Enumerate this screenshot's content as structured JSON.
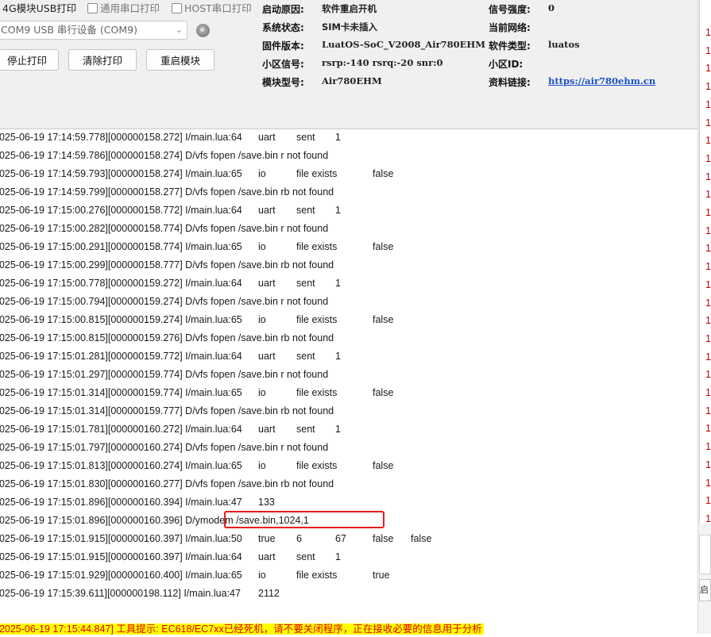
{
  "top": {
    "mode_4g_usb": "4G模块USB打印",
    "mode_uart": "通用串口打印",
    "mode_host": "HOST串口打印",
    "port_value": "COM9 USB 串行设备 (COM9)",
    "stop_label": "停止打印",
    "clear_label": "清除打印",
    "reboot_label": "重启模块"
  },
  "info": {
    "boot_reason_label": "启动原因:",
    "boot_reason": "软件重启开机",
    "sys_state_label": "系统状态:",
    "sys_state": "SIM卡未插入",
    "firmware_label": "固件版本:",
    "firmware": "LuatOS-SoC_V2008_Air780EHM",
    "cell_label": "小区信号:",
    "cell": "rsrp:-140 rsrq:-20 snr:0",
    "model_label": "模块型号:",
    "model": "Air780EHM",
    "signal_label": "信号强度:",
    "signal": "0",
    "network_label": "当前网络:",
    "network": "",
    "soft_type_label": "软件类型:",
    "soft_type": "luatos",
    "cell_id_label": "小区ID:",
    "cell_id": "",
    "link_label": "资料链接:",
    "link": "https://air780ehm.cn"
  },
  "log": [
    {
      "ts": "2025-06-19 17:14:59.778][000000158.272] I/main.lua:64",
      "a": "uart",
      "b": "sent",
      "c": "1"
    },
    {
      "ts": "2025-06-19 17:14:59.786][000000158.274] D/vfs fopen /save.bin r not found"
    },
    {
      "ts": "2025-06-19 17:14:59.793][000000158.274] I/main.lua:65",
      "a": "io",
      "b": "file exists",
      "c": "false"
    },
    {
      "ts": "2025-06-19 17:14:59.799][000000158.277] D/vfs fopen /save.bin rb not found"
    },
    {
      "ts": "2025-06-19 17:15:00.276][000000158.772] I/main.lua:64",
      "a": "uart",
      "b": "sent",
      "c": "1"
    },
    {
      "ts": "2025-06-19 17:15:00.282][000000158.774] D/vfs fopen /save.bin r not found"
    },
    {
      "ts": "2025-06-19 17:15:00.291][000000158.774] I/main.lua:65",
      "a": "io",
      "b": "file exists",
      "c": "false"
    },
    {
      "ts": "2025-06-19 17:15:00.299][000000158.777] D/vfs fopen /save.bin rb not found"
    },
    {
      "ts": "2025-06-19 17:15:00.778][000000159.272] I/main.lua:64",
      "a": "uart",
      "b": "sent",
      "c": "1"
    },
    {
      "ts": "2025-06-19 17:15:00.794][000000159.274] D/vfs fopen /save.bin r not found"
    },
    {
      "ts": "2025-06-19 17:15:00.815][000000159.274] I/main.lua:65",
      "a": "io",
      "b": "file exists",
      "c": "false"
    },
    {
      "ts": "2025-06-19 17:15:00.815][000000159.276] D/vfs fopen /save.bin rb not found"
    },
    {
      "ts": "2025-06-19 17:15:01.281][000000159.772] I/main.lua:64",
      "a": "uart",
      "b": "sent",
      "c": "1"
    },
    {
      "ts": "2025-06-19 17:15:01.297][000000159.774] D/vfs fopen /save.bin r not found"
    },
    {
      "ts": "2025-06-19 17:15:01.314][000000159.774] I/main.lua:65",
      "a": "io",
      "b": "file exists",
      "c": "false"
    },
    {
      "ts": "2025-06-19 17:15:01.314][000000159.777] D/vfs fopen /save.bin rb not found"
    },
    {
      "ts": "2025-06-19 17:15:01.781][000000160.272] I/main.lua:64",
      "a": "uart",
      "b": "sent",
      "c": "1"
    },
    {
      "ts": "2025-06-19 17:15:01.797][000000160.274] D/vfs fopen /save.bin r not found"
    },
    {
      "ts": "2025-06-19 17:15:01.813][000000160.274] I/main.lua:65",
      "a": "io",
      "b": "file exists",
      "c": "false"
    },
    {
      "ts": "2025-06-19 17:15:01.830][000000160.277] D/vfs fopen /save.bin rb not found"
    },
    {
      "ts": "2025-06-19 17:15:01.896][000000160.394] I/main.lua:47",
      "a": "133"
    },
    {
      "ts": "2025-06-19 17:15:01.896][000000160.396] D/ymodem /save.bin,1024,1"
    },
    {
      "ts": "2025-06-19 17:15:01.915][000000160.397] I/main.lua:50",
      "a": "true",
      "b": "6",
      "c": "67",
      "d": "false",
      "e": "false"
    },
    {
      "ts": "2025-06-19 17:15:01.915][000000160.397] I/main.lua:64",
      "a": "uart",
      "b": "sent",
      "c": "1"
    },
    {
      "ts": "2025-06-19 17:15:01.929][000000160.400] I/main.lua:65",
      "a": "io",
      "b": "file exists",
      "c": "true"
    },
    {
      "ts": "2025-06-19 17:15:39.611][000000198.112] I/main.lua:47",
      "a": "2112"
    }
  ],
  "warning": "2025-06-19 17:15:44.847] 工具提示: EC618/EC7xx已经死机，请不要关闭程序，正在接收必要的信息用于分析",
  "right_digits": [
    "1",
    "1",
    "1",
    "1",
    "1",
    "1",
    "1",
    "1",
    "1",
    "1",
    "1",
    "1",
    "1",
    "1",
    "1",
    "1",
    "1",
    "1",
    "1",
    "1",
    "1",
    "1",
    "1",
    "1",
    "1",
    "1",
    "1",
    "1"
  ],
  "right_button_label": "启"
}
